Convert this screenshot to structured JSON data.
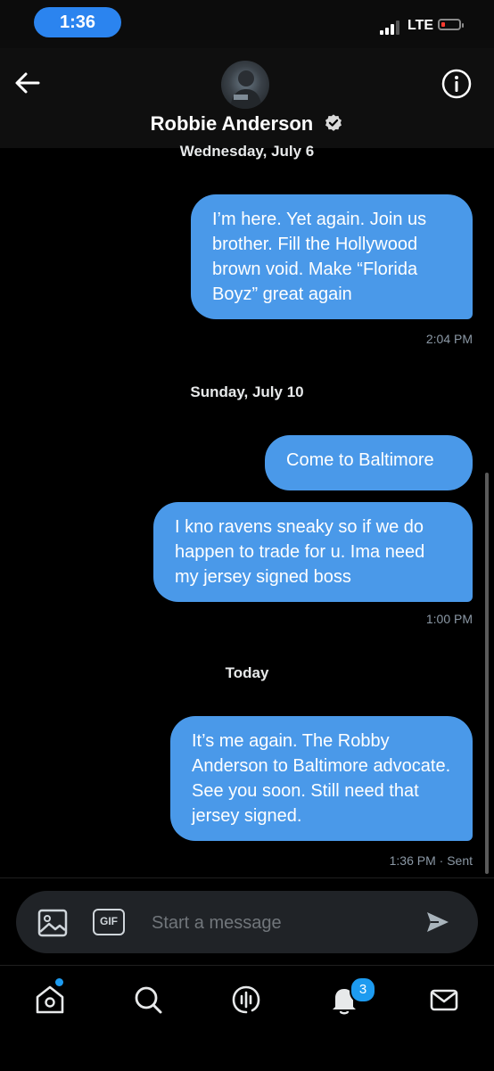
{
  "status_bar": {
    "time": "1:36",
    "network": "LTE"
  },
  "header": {
    "contact_name": "Robbie Anderson"
  },
  "conversation": [
    {
      "type": "date",
      "label": "Wednesday, July 6"
    },
    {
      "type": "message",
      "text": "I’m here. Yet again. Join us brother. Fill the Hollywood brown void. Make “Florida Boyz” great again"
    },
    {
      "type": "meta",
      "text": "2:04 PM"
    },
    {
      "type": "date",
      "label": "Sunday, July 10"
    },
    {
      "type": "message",
      "text": "Come to Baltimore"
    },
    {
      "type": "message",
      "text": "I kno ravens sneaky so if we do happen to trade for u. Ima need my jersey signed boss"
    },
    {
      "type": "meta",
      "text": "1:00 PM"
    },
    {
      "type": "date",
      "label": "Today"
    },
    {
      "type": "message",
      "text": "It’s me again. The Robby Anderson to Baltimore advocate. See you soon. Still need that jersey signed."
    },
    {
      "type": "meta",
      "text": "1:36 PM · Sent"
    }
  ],
  "composer": {
    "gif_label": "GIF",
    "placeholder": "Start a message"
  },
  "tabbar": {
    "notifications_count": "3"
  },
  "colors": {
    "bubble": "#4a99e9",
    "accent": "#1d9bf0",
    "background": "#000000"
  }
}
